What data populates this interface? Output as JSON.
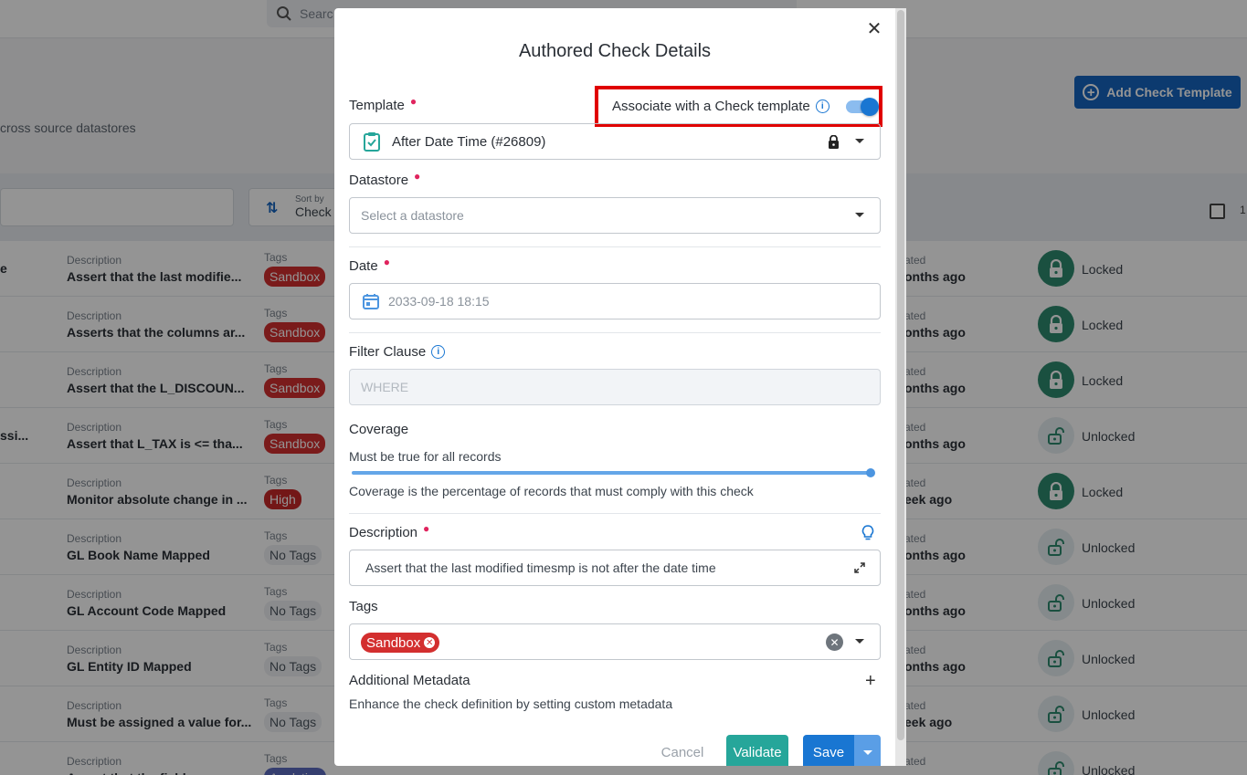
{
  "background": {
    "search_placeholder": "Searc",
    "subtitle": "cross source datastores",
    "add_template_label": "Add Check Template",
    "sort_small": "Sort by",
    "sort_value": "Check",
    "count_fragment": "1",
    "rows": [
      {
        "edge": "e",
        "desc_label": "Description",
        "desc": "Assert that the last modifie...",
        "tags_label": "Tags",
        "tag": "Sandbox",
        "tag_kind": "sandbox",
        "upd_label": "ated",
        "upd": "onths ago",
        "lock": "Locked",
        "locked": true
      },
      {
        "edge": "",
        "desc_label": "Description",
        "desc": "Asserts that the columns ar...",
        "tags_label": "Tags",
        "tag": "Sandbox",
        "tag_kind": "sandbox",
        "upd_label": "ated",
        "upd": "onths ago",
        "lock": "Locked",
        "locked": true
      },
      {
        "edge": "",
        "desc_label": "Description",
        "desc": "Assert that the L_DISCOUN...",
        "tags_label": "Tags",
        "tag": "Sandbox",
        "tag_kind": "sandbox",
        "upd_label": "ated",
        "upd": "onths ago",
        "lock": "Locked",
        "locked": true
      },
      {
        "edge": "ssi...",
        "desc_label": "Description",
        "desc": "Assert that L_TAX is <= tha...",
        "tags_label": "Tags",
        "tag": "Sandbox",
        "tag_kind": "sandbox",
        "upd_label": "ated",
        "upd": "onths ago",
        "lock": "Unlocked",
        "locked": false
      },
      {
        "edge": "",
        "desc_label": "Description",
        "desc": "Monitor absolute change in ...",
        "tags_label": "Tags",
        "tag": "High",
        "tag_kind": "high",
        "upd_label": "ated",
        "upd": "eek ago",
        "lock": "Locked",
        "locked": true
      },
      {
        "edge": "",
        "desc_label": "Description",
        "desc": "GL Book Name Mapped",
        "tags_label": "Tags",
        "tag": "No Tags",
        "tag_kind": "none",
        "upd_label": "ated",
        "upd": "onths ago",
        "lock": "Unlocked",
        "locked": false
      },
      {
        "edge": "",
        "desc_label": "Description",
        "desc": "GL Account Code Mapped",
        "tags_label": "Tags",
        "tag": "No Tags",
        "tag_kind": "none",
        "upd_label": "ated",
        "upd": "onths ago",
        "lock": "Unlocked",
        "locked": false
      },
      {
        "edge": "",
        "desc_label": "Description",
        "desc": "GL Entity ID Mapped",
        "tags_label": "Tags",
        "tag": "No Tags",
        "tag_kind": "none",
        "upd_label": "ated",
        "upd": "onths ago",
        "lock": "Unlocked",
        "locked": false
      },
      {
        "edge": "",
        "desc_label": "Description",
        "desc": "Must be assigned a value for...",
        "tags_label": "Tags",
        "tag": "No Tags",
        "tag_kind": "none",
        "upd_label": "ated",
        "upd": "eek ago",
        "lock": "Unlocked",
        "locked": false
      },
      {
        "edge": "",
        "desc_label": "Description",
        "desc": "Assert that the field ...",
        "tags_label": "Tags",
        "tag": "Analytics",
        "tag_kind": "analytics",
        "upd_label": "ated",
        "upd": "",
        "lock": "Unlocked",
        "locked": false
      }
    ]
  },
  "modal": {
    "title": "Authored Check Details",
    "close_icon": "close-icon",
    "template_label": "Template",
    "associate_label": "Associate with a Check template",
    "associate_on": true,
    "template_value": "After Date Time (#26809)",
    "datastore_label": "Datastore",
    "datastore_placeholder": "Select a datastore",
    "date_label": "Date",
    "date_value": "2033-09-18 18:15",
    "filter_label": "Filter Clause",
    "filter_placeholder": "WHERE",
    "coverage_label": "Coverage",
    "coverage_hint": "Must be true for all records",
    "coverage_value": 1.0,
    "coverage_help": "Coverage is the percentage of records that must comply with this check",
    "description_label": "Description",
    "description_value": "Assert that the last modified timesmp is not after the date time",
    "tags_label": "Tags",
    "tag_chip": "Sandbox",
    "metadata_label": "Additional Metadata",
    "metadata_hint": "Enhance the check definition by setting custom metadata",
    "cancel_label": "Cancel",
    "validate_label": "Validate",
    "save_label": "Save"
  },
  "colors": {
    "primary": "#1976d2",
    "validate": "#26a69a",
    "sandbox_tag": "#d32f2f",
    "highlight_box": "#e00000",
    "locked": "#2e8b6f"
  }
}
